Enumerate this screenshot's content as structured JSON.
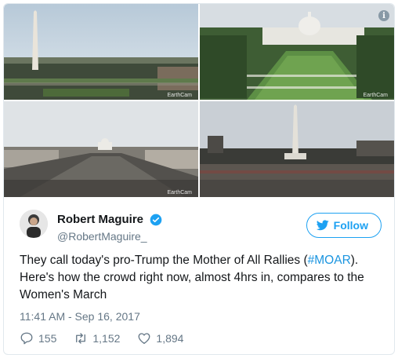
{
  "photos": [
    {
      "name": "washington-monument-view",
      "watermark": "EarthCam"
    },
    {
      "name": "capitol-mall-view",
      "watermark": "EarthCam"
    },
    {
      "name": "womens-march-crowd-capitol",
      "watermark": "EarthCam"
    },
    {
      "name": "moar-crowd-monument",
      "watermark": ""
    }
  ],
  "info_icon": "i",
  "author": {
    "display_name": "Robert Maguire",
    "handle": "@RobertMaguire_",
    "verified": true
  },
  "follow_label": "Follow",
  "tweet": {
    "text_before": "They call today's pro-Trump the Mother of All Rallies (",
    "hashtag": "#MOAR",
    "text_after": "). Here's how the crowd right now, almost 4hrs in, compares to the Women's March",
    "timestamp": "11:41 AM - Sep 16, 2017"
  },
  "stats": {
    "replies": "155",
    "retweets": "1,152",
    "likes": "1,894"
  },
  "colors": {
    "accent": "#1da1f2",
    "hashtag": "#1b95e0",
    "muted": "#657786",
    "border": "#e1e8ed"
  },
  "icons": {
    "reply": "reply-icon",
    "retweet": "retweet-icon",
    "like": "heart-icon",
    "verified": "verified-badge-icon",
    "twitter": "twitter-bird-icon"
  }
}
